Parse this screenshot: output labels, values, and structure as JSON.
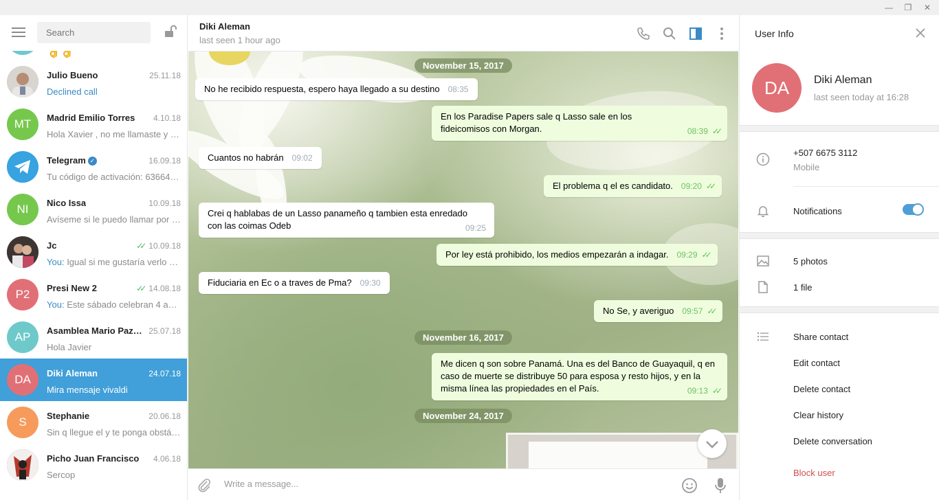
{
  "colors": {
    "accent": "#419fd9",
    "outgoing": "#effdde",
    "danger": "#d14e4e",
    "read_ticks": "#4dbb63"
  },
  "window": {
    "minimize": "—",
    "restore": "❐",
    "close": "✕"
  },
  "search": {
    "placeholder": "Search"
  },
  "chats": [
    {
      "avatar_text": "AP",
      "avatar_color": "#6ec9cb",
      "name": "",
      "date": "",
      "preview": "👌👌",
      "top_partial": true
    },
    {
      "avatar_text": "",
      "avatar_color": "#c9c3bb",
      "avatar_kind": "photo",
      "name": "Julio Bueno",
      "date": "25.11.18",
      "preview": "Declined call",
      "preview_style": "link"
    },
    {
      "avatar_text": "MT",
      "avatar_color": "#65aadd",
      "name": "Madrid Emilio Torres",
      "date": "4.10.18",
      "preview": "Hola Xavier , no me llamaste y …"
    },
    {
      "avatar_text": "",
      "avatar_color": "#37a3e0",
      "avatar_kind": "telegram",
      "name": "Telegram",
      "verified": true,
      "date": "16.09.18",
      "preview": "Tu código de activación: 63664 …"
    },
    {
      "avatar_text": "NI",
      "avatar_color": "#76c84d",
      "name": "Nico Issa",
      "date": "10.09.18",
      "preview": "Avíseme si le puedo llamar por …"
    },
    {
      "avatar_text": "",
      "avatar_color": "#5a4a44",
      "avatar_kind": "photo",
      "name": "Jc",
      "ticks": true,
      "date": "10.09.18",
      "you": "You:",
      "preview": "Igual si me gustaría verlo s…"
    },
    {
      "avatar_text": "P2",
      "avatar_color": "#e17076",
      "name": "Presi New 2",
      "ticks": true,
      "date": "14.08.18",
      "you": "You:",
      "preview": "Este sábado celebran 4 a…"
    },
    {
      "avatar_text": "AP",
      "avatar_color": "#6ec9cb",
      "name": "Asamblea Mario Paz…",
      "date": "25.07.18",
      "preview": "Hola Javier"
    },
    {
      "avatar_text": "DA",
      "avatar_color": "#e17076",
      "name": "Diki Aleman",
      "date": "24.07.18",
      "preview": "Mira mensaje vivaldi",
      "active": true
    },
    {
      "avatar_text": "S",
      "avatar_color": "#f69b5c",
      "name": "Stephanie",
      "date": "20.06.18",
      "preview": "Sin q llegue el y te ponga obstá…"
    },
    {
      "avatar_text": "",
      "avatar_color": "#b53a2e",
      "avatar_kind": "photo",
      "name": "Picho Juan Francisco",
      "date": "4.06.18",
      "preview": "Sercop"
    }
  ],
  "header": {
    "name": "Diki Aleman",
    "status": "last seen 1 hour ago"
  },
  "dates": [
    "November 15, 2017",
    "November 16, 2017",
    "November 24, 2017"
  ],
  "messages": [
    {
      "dir": "in",
      "text": "No he recibido respuesta, espero haya llegado a su destino",
      "time": "08:35"
    },
    {
      "dir": "out",
      "text": "En los Paradise Papers sale q Lasso sale en los fideicomisos con Morgan.",
      "time": "08:39"
    },
    {
      "dir": "in",
      "text": "Cuantos no habrán",
      "time": "09:02"
    },
    {
      "dir": "out",
      "text": "El problema q el es candidato.",
      "time": "09:20"
    },
    {
      "dir": "in",
      "text": "Crei q hablabas de un Lasso panameño q tambien esta enredado con las coimas Odeb",
      "time": "09:25"
    },
    {
      "dir": "out",
      "text": "Por ley está prohibido, los medios empezarán a indagar.",
      "time": "09:29"
    },
    {
      "dir": "in",
      "text": "Fiduciaria en Ec o a traves de Pma?",
      "time": "09:30"
    },
    {
      "dir": "out",
      "text": "No Se, y averiguo",
      "time": "09:57"
    },
    {
      "dir": "out",
      "text": "Me dicen q son sobre Panamá. Una es del Banco de Guayaquil, q en caso de muerte se distribuye 50 para esposa y resto hijos, y en la misma línea las propiedades en el País.",
      "time": "09:13"
    }
  ],
  "composer": {
    "placeholder": "Write a message..."
  },
  "user_info": {
    "title": "User Info",
    "avatar_text": "DA",
    "name": "Diki Aleman",
    "seen": "last seen today at 16:28",
    "phone": "+507 6675 3112",
    "phone_label": "Mobile",
    "notifications_label": "Notifications",
    "notifications_on": true,
    "photos": "5 photos",
    "files": "1 file",
    "actions": [
      "Share contact",
      "Edit contact",
      "Delete contact",
      "Clear history",
      "Delete conversation"
    ],
    "block": "Block user"
  }
}
